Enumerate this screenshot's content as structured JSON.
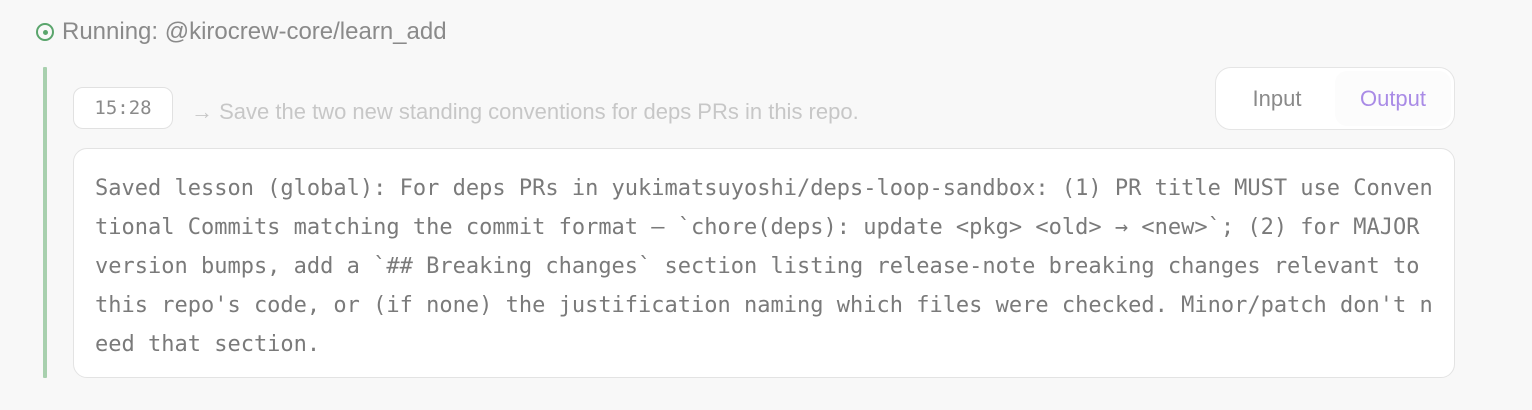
{
  "header": {
    "status_icon": "running-circle-icon",
    "text": "Running: @kirocrew-core/learn_add",
    "accent": "#5aa56c"
  },
  "entry": {
    "time": "15:28",
    "prompt": "→ Save the two new standing conventions for deps PRs in this repo."
  },
  "tabs": {
    "input_label": "Input",
    "output_label": "Output",
    "active": "Output",
    "active_color": "#a98be6"
  },
  "output": {
    "text": "Saved lesson (global): For deps PRs in yukimatsuyoshi/deps-loop-sandbox: (1) PR title MUST use Conventional Commits matching the commit format — `chore(deps): update <pkg> <old> → <new>`; (2) for MAJOR version bumps, add a `## Breaking changes` section listing release-note breaking changes relevant to this repo's code, or (if none) the justification naming which files were checked. Minor/patch don't need that section."
  }
}
